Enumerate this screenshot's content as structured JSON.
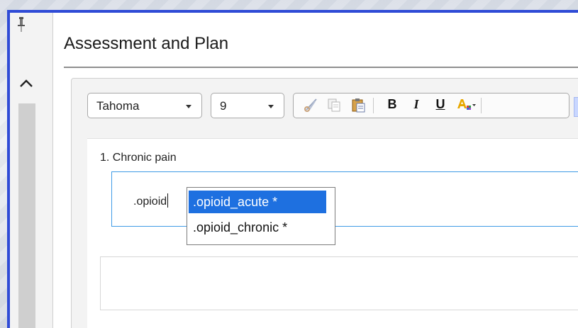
{
  "section": {
    "title": "Assessment and Plan"
  },
  "toolbar": {
    "font_value": "Tahoma",
    "size_value": "9",
    "bold_label": "B",
    "italic_label": "I",
    "underline_label": "U"
  },
  "note": {
    "problem_label": "1. Chronic pain",
    "typed_text": ".opioid"
  },
  "autocomplete": {
    "items": [
      {
        "label": ".opioid_acute *",
        "selected": true
      },
      {
        "label": ".opioid_chronic *",
        "selected": false
      }
    ]
  },
  "colors": {
    "window_border": "#2f4bd6",
    "selection": "#1e70e0",
    "field_focus": "#3f9be6"
  },
  "icons": [
    "pin-icon",
    "chevron-up-icon",
    "cut-icon",
    "copy-icon",
    "paste-icon",
    "font-color-icon"
  ]
}
